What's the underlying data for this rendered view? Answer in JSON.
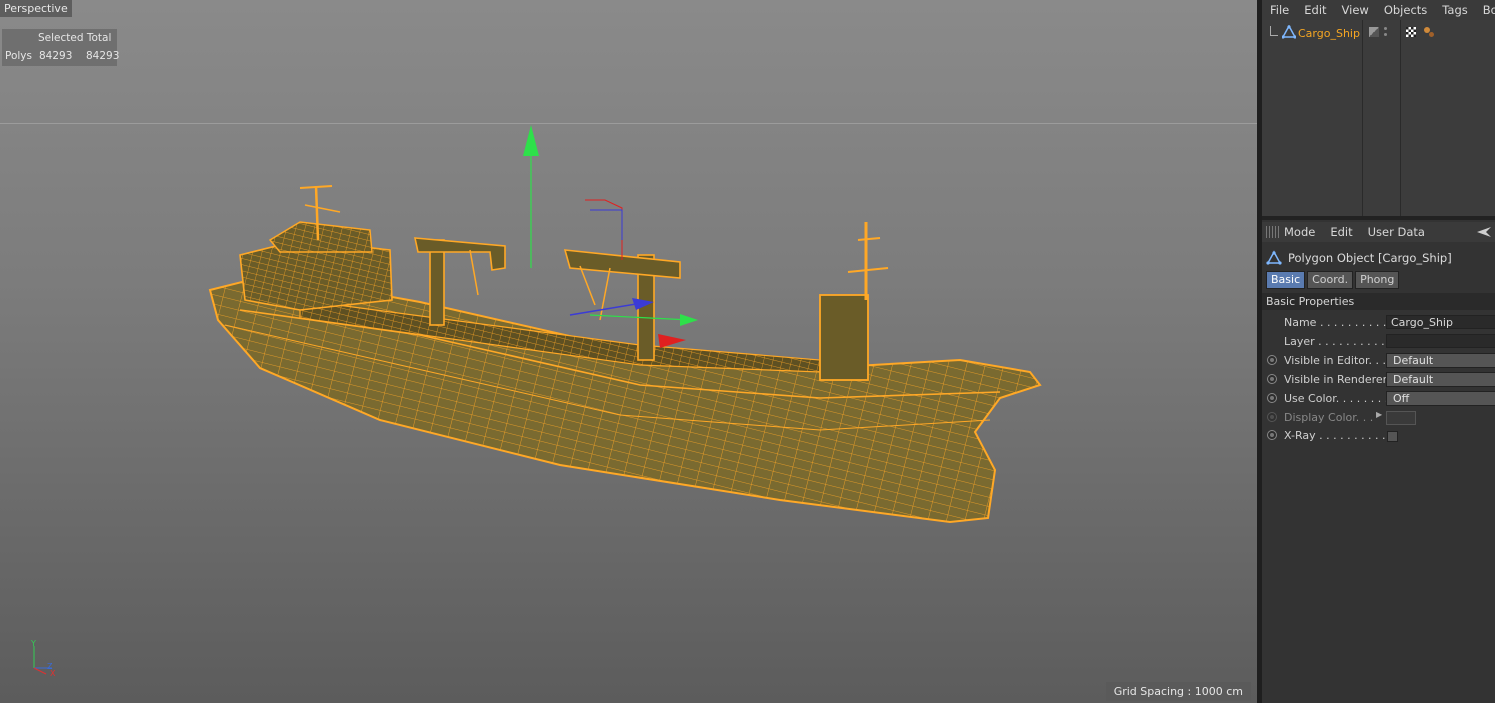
{
  "viewport": {
    "title": "Perspective",
    "hud": {
      "header": "Selected Total",
      "label": "Polys",
      "selected": "84293",
      "total": "84293"
    },
    "grid_spacing": "Grid Spacing : 1000 cm",
    "axis": {
      "y": "Y",
      "z": "Z",
      "x": "X"
    }
  },
  "object_manager": {
    "menu": [
      "File",
      "Edit",
      "View",
      "Objects",
      "Tags",
      "Bo"
    ],
    "object": {
      "name": "Cargo_Ship",
      "icon": "polygon-object-icon"
    }
  },
  "attribute_manager": {
    "menu": [
      "Mode",
      "Edit",
      "User Data"
    ],
    "title": "Polygon Object [Cargo_Ship]",
    "tabs": [
      {
        "label": "Basic",
        "active": true
      },
      {
        "label": "Coord.",
        "active": false
      },
      {
        "label": "Phong",
        "active": false
      }
    ],
    "section": "Basic Properties",
    "properties": {
      "name": {
        "label": "Name . . . . . . . . . . .",
        "value": "Cargo_Ship"
      },
      "layer": {
        "label": "Layer . . . . . . . . . . .",
        "value": ""
      },
      "visible_editor": {
        "label": "Visible in Editor. . .",
        "value": "Default"
      },
      "visible_renderer": {
        "label": "Visible in Renderer",
        "value": "Default"
      },
      "use_color": {
        "label": "Use Color. . . . . . . .",
        "value": "Off"
      },
      "display_color": {
        "label": "Display Color. . .",
        "value": ""
      },
      "xray": {
        "label": "X-Ray . . . . . . . . . . .",
        "checked": false
      }
    }
  },
  "colors": {
    "selection": "#f5a623",
    "wire": "#ffa826",
    "hull_fill": "#7a6a30",
    "active_tab": "#5a7bb0"
  }
}
